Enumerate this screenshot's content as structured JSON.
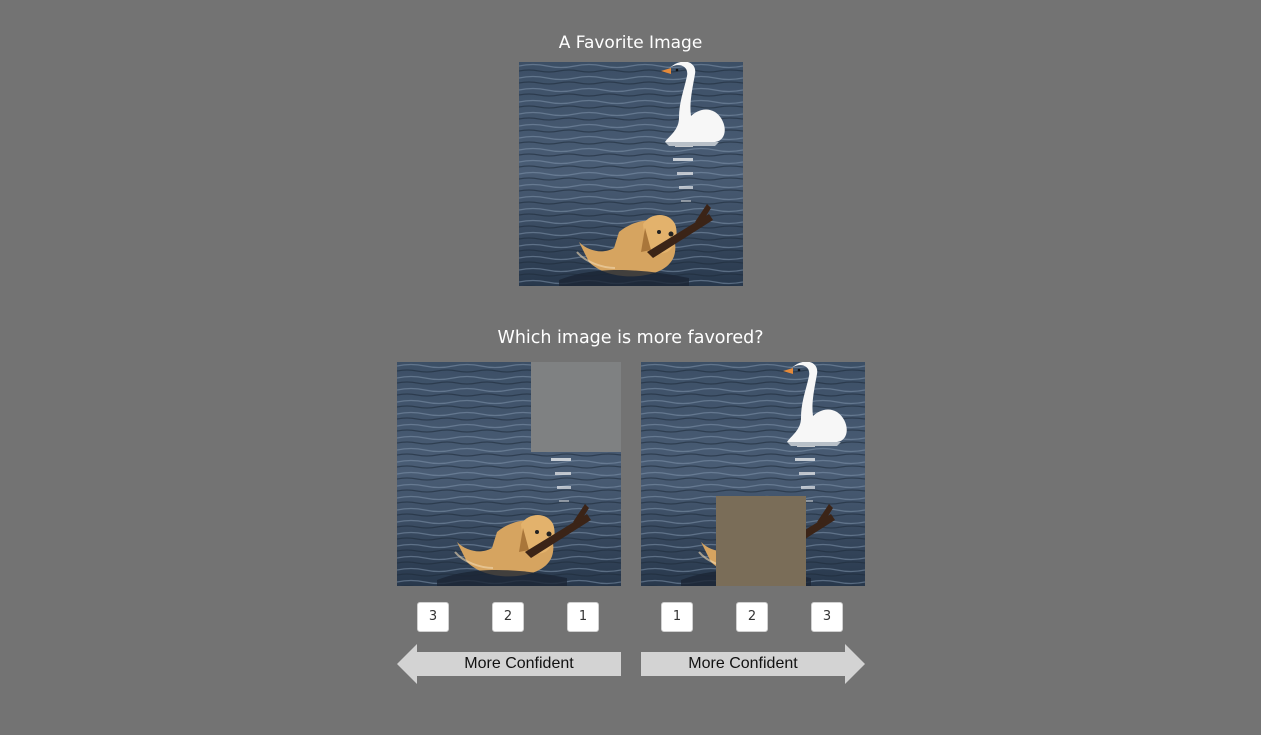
{
  "reference": {
    "title": "A Favorite Image"
  },
  "question": {
    "title": "Which image is more favored?"
  },
  "left_choice": {
    "buttons": [
      "3",
      "2",
      "1"
    ],
    "arrow_label": "More Confident"
  },
  "right_choice": {
    "buttons": [
      "1",
      "2",
      "3"
    ],
    "arrow_label": "More Confident"
  },
  "colors": {
    "background": "#737373",
    "occluder_left": "#7f8182",
    "occluder_right": "#7a6d58",
    "arrow_fill": "#d3d3d3"
  },
  "icons": {
    "left_arrow": "arrow-left-icon",
    "right_arrow": "arrow-right-icon"
  }
}
